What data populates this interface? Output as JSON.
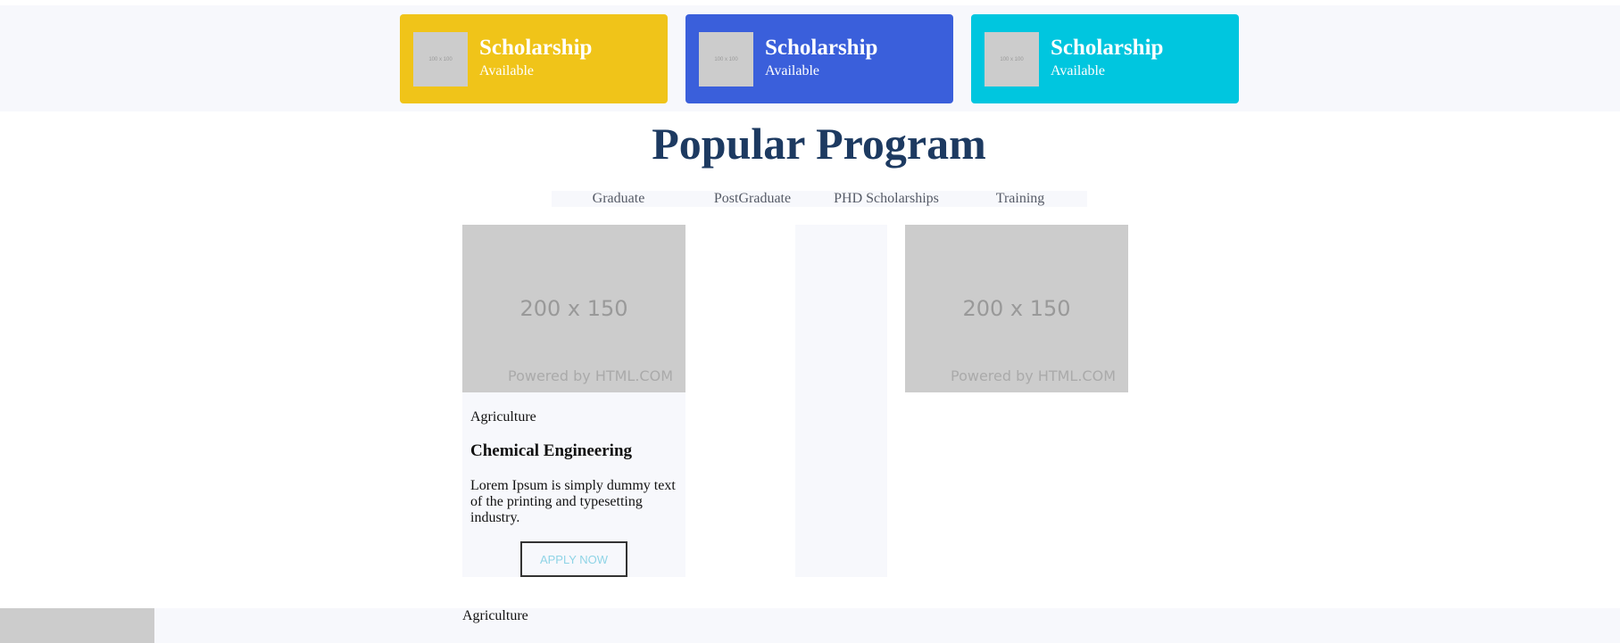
{
  "scholarship_cards": [
    {
      "thumb": "100 x 100",
      "title": "Scholarship",
      "subtitle": "Available",
      "color": "#f0c419"
    },
    {
      "thumb": "100 x 100",
      "title": "Scholarship",
      "subtitle": "Available",
      "color": "#3a5fdb"
    },
    {
      "thumb": "100 x 100",
      "title": "Scholarship",
      "subtitle": "Available",
      "color": "#00c6df"
    }
  ],
  "section": {
    "title": "Popular Program"
  },
  "tabs": [
    "Graduate",
    "PostGraduate",
    "PHD Scholarships",
    "Training"
  ],
  "program_card": {
    "image_dim": "200 x 150",
    "image_powered": "Powered by HTML.COM",
    "category": "Agriculture",
    "title": "Chemical Engineering",
    "description": "Lorem Ipsum is simply dummy text of the printing and typesetting industry.",
    "button_label": "APPLY NOW"
  },
  "second_card": {
    "image_dim": "200 x 150",
    "image_powered": "Powered by HTML.COM"
  },
  "bottom": {
    "category": "Agriculture"
  },
  "colors": {
    "background": "#f7f8fc",
    "heading": "#1d3a61",
    "placeholder": "#cccccc"
  }
}
